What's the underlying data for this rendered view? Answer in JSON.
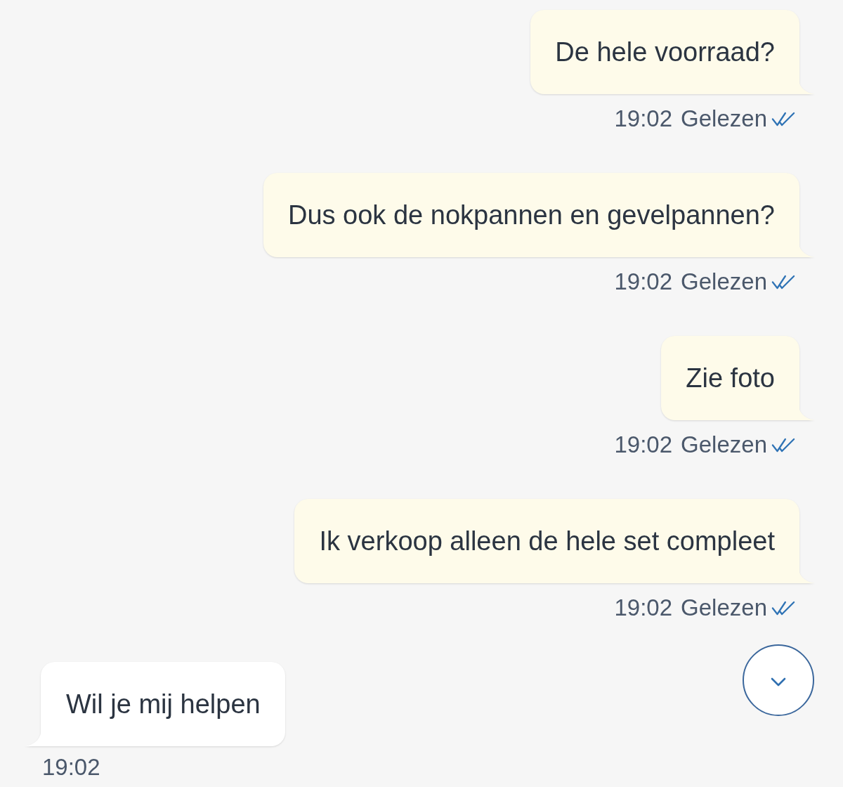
{
  "messages": [
    {
      "kind": "outgoing",
      "text": "De hele voorraad?",
      "time": "19:02",
      "status": "Gelezen",
      "read": true
    },
    {
      "kind": "outgoing",
      "text": "Dus ook de nokpannen en gevelpannen?",
      "time": "19:02",
      "status": "Gelezen",
      "read": true
    },
    {
      "kind": "outgoing",
      "text": "Zie foto",
      "time": "19:02",
      "status": "Gelezen",
      "read": true
    },
    {
      "kind": "outgoing",
      "text": "Ik verkoop alleen de hele set compleet",
      "time": "19:02",
      "status": "Gelezen",
      "read": true
    },
    {
      "kind": "incoming",
      "text": "Wil je mij helpen",
      "time": "19:02"
    }
  ]
}
